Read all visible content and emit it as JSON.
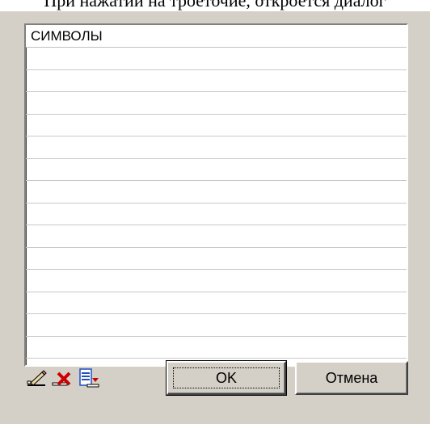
{
  "caption": "При нажатии на троеточие, откроется диалог",
  "list": {
    "header": "СИМВОЛЫ",
    "rows": [
      "",
      "",
      "",
      "",
      "",
      "",
      "",
      "",
      "",
      "",
      "",
      "",
      "",
      ""
    ]
  },
  "toolbar": {
    "icons": [
      "edit-icon",
      "delete-icon",
      "insert-row-icon"
    ]
  },
  "buttons": {
    "ok_label": "OK",
    "cancel_label": "Отмена"
  },
  "colors": {
    "dialog_bg": "#d4d0c8",
    "delete_icon": "#cc0000",
    "insert_icon": "#1f4fbf"
  }
}
